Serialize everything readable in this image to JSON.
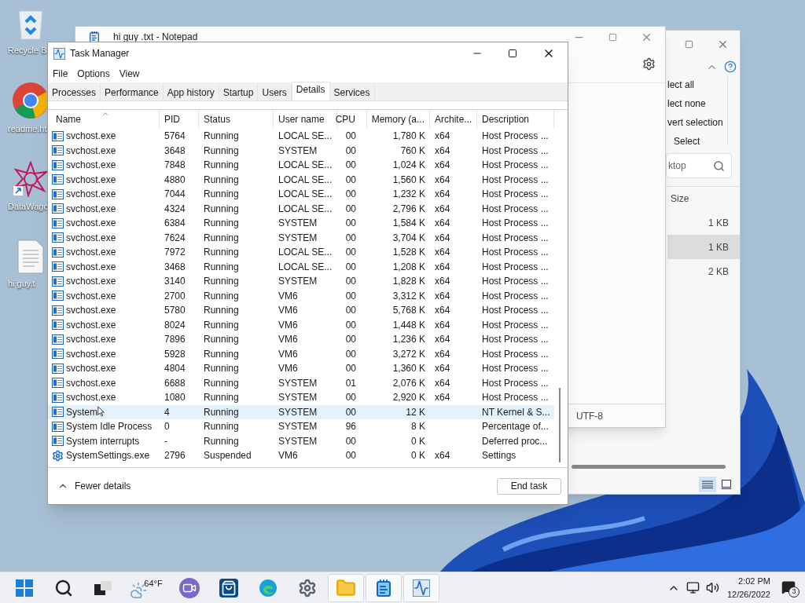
{
  "desktop_icons": [
    {
      "kind": "recycle",
      "label": "Recycle B"
    },
    {
      "kind": "browser",
      "label": "readme.ht"
    },
    {
      "kind": "shortcut",
      "label": "DataWago"
    },
    {
      "kind": "text_file",
      "label": "hi guy.t"
    }
  ],
  "explorer": {
    "ribbon_items": [
      "lect all",
      "lect none",
      "vert selection",
      "Select"
    ],
    "search": {
      "value": "ktop"
    },
    "column": "Size",
    "rows": [
      {
        "size": "1 KB",
        "selected": false
      },
      {
        "size": "1 KB",
        "selected": true
      },
      {
        "size": "2 KB",
        "selected": false
      }
    ],
    "views": [
      {
        "kind": "details",
        "selected": true
      },
      {
        "kind": "tiles",
        "selected": false
      }
    ]
  },
  "notepad": {
    "title": "hi guy .txt - Notepad",
    "encoding": "UTF-8"
  },
  "task_manager": {
    "title": "Task Manager",
    "menu": [
      "File",
      "Options",
      "View"
    ],
    "tabs": [
      {
        "label": "Processes",
        "selected": false
      },
      {
        "label": "Performance",
        "selected": false
      },
      {
        "label": "App history",
        "selected": false
      },
      {
        "label": "Startup",
        "selected": false
      },
      {
        "label": "Users",
        "selected": false
      },
      {
        "label": "Details",
        "selected": true
      },
      {
        "label": "Services",
        "selected": false
      }
    ],
    "columns": [
      "Name",
      "PID",
      "Status",
      "User name",
      "CPU",
      "Memory (a...",
      "Archite...",
      "Description"
    ],
    "rows": [
      {
        "kind": "app",
        "name": "svchost.exe",
        "pid": "5764",
        "status": "Running",
        "user": "LOCAL SE...",
        "cpu": "00",
        "memory": "1,780 K",
        "arch": "x64",
        "description": "Host Process ...",
        "selected": false
      },
      {
        "kind": "app",
        "name": "svchost.exe",
        "pid": "3648",
        "status": "Running",
        "user": "SYSTEM",
        "cpu": "00",
        "memory": "760 K",
        "arch": "x64",
        "description": "Host Process ...",
        "selected": false
      },
      {
        "kind": "app",
        "name": "svchost.exe",
        "pid": "7848",
        "status": "Running",
        "user": "LOCAL SE...",
        "cpu": "00",
        "memory": "1,024 K",
        "arch": "x64",
        "description": "Host Process ...",
        "selected": false
      },
      {
        "kind": "app",
        "name": "svchost.exe",
        "pid": "4880",
        "status": "Running",
        "user": "LOCAL SE...",
        "cpu": "00",
        "memory": "1,560 K",
        "arch": "x64",
        "description": "Host Process ...",
        "selected": false
      },
      {
        "kind": "app",
        "name": "svchost.exe",
        "pid": "7044",
        "status": "Running",
        "user": "LOCAL SE...",
        "cpu": "00",
        "memory": "1,232 K",
        "arch": "x64",
        "description": "Host Process ...",
        "selected": false
      },
      {
        "kind": "app",
        "name": "svchost.exe",
        "pid": "4324",
        "status": "Running",
        "user": "LOCAL SE...",
        "cpu": "00",
        "memory": "2,796 K",
        "arch": "x64",
        "description": "Host Process ...",
        "selected": false
      },
      {
        "kind": "app",
        "name": "svchost.exe",
        "pid": "6384",
        "status": "Running",
        "user": "SYSTEM",
        "cpu": "00",
        "memory": "1,584 K",
        "arch": "x64",
        "description": "Host Process ...",
        "selected": false
      },
      {
        "kind": "app",
        "name": "svchost.exe",
        "pid": "7624",
        "status": "Running",
        "user": "SYSTEM",
        "cpu": "00",
        "memory": "3,704 K",
        "arch": "x64",
        "description": "Host Process ...",
        "selected": false
      },
      {
        "kind": "app",
        "name": "svchost.exe",
        "pid": "7972",
        "status": "Running",
        "user": "LOCAL SE...",
        "cpu": "00",
        "memory": "1,528 K",
        "arch": "x64",
        "description": "Host Process ...",
        "selected": false
      },
      {
        "kind": "app",
        "name": "svchost.exe",
        "pid": "3468",
        "status": "Running",
        "user": "LOCAL SE...",
        "cpu": "00",
        "memory": "1,208 K",
        "arch": "x64",
        "description": "Host Process ...",
        "selected": false
      },
      {
        "kind": "app",
        "name": "svchost.exe",
        "pid": "3140",
        "status": "Running",
        "user": "SYSTEM",
        "cpu": "00",
        "memory": "1,828 K",
        "arch": "x64",
        "description": "Host Process ...",
        "selected": false
      },
      {
        "kind": "app",
        "name": "svchost.exe",
        "pid": "2700",
        "status": "Running",
        "user": "VM6",
        "cpu": "00",
        "memory": "3,312 K",
        "arch": "x64",
        "description": "Host Process ...",
        "selected": false
      },
      {
        "kind": "app",
        "name": "svchost.exe",
        "pid": "5780",
        "status": "Running",
        "user": "VM6",
        "cpu": "00",
        "memory": "5,768 K",
        "arch": "x64",
        "description": "Host Process ...",
        "selected": false
      },
      {
        "kind": "app",
        "name": "svchost.exe",
        "pid": "8024",
        "status": "Running",
        "user": "VM6",
        "cpu": "00",
        "memory": "1,448 K",
        "arch": "x64",
        "description": "Host Process ...",
        "selected": false
      },
      {
        "kind": "app",
        "name": "svchost.exe",
        "pid": "7896",
        "status": "Running",
        "user": "VM6",
        "cpu": "00",
        "memory": "1,236 K",
        "arch": "x64",
        "description": "Host Process ...",
        "selected": false
      },
      {
        "kind": "app",
        "name": "svchost.exe",
        "pid": "5928",
        "status": "Running",
        "user": "VM6",
        "cpu": "00",
        "memory": "3,272 K",
        "arch": "x64",
        "description": "Host Process ...",
        "selected": false
      },
      {
        "kind": "app",
        "name": "svchost.exe",
        "pid": "4804",
        "status": "Running",
        "user": "VM6",
        "cpu": "00",
        "memory": "1,360 K",
        "arch": "x64",
        "description": "Host Process ...",
        "selected": false
      },
      {
        "kind": "app",
        "name": "svchost.exe",
        "pid": "6688",
        "status": "Running",
        "user": "SYSTEM",
        "cpu": "01",
        "memory": "2,076 K",
        "arch": "x64",
        "description": "Host Process ...",
        "selected": false
      },
      {
        "kind": "app",
        "name": "svchost.exe",
        "pid": "1080",
        "status": "Running",
        "user": "SYSTEM",
        "cpu": "00",
        "memory": "2,920 K",
        "arch": "x64",
        "description": "Host Process ...",
        "selected": false
      },
      {
        "kind": "app",
        "name": "System",
        "pid": "4",
        "status": "Running",
        "user": "SYSTEM",
        "cpu": "00",
        "memory": "12 K",
        "description": "NT Kernel & S...",
        "selected": true
      },
      {
        "kind": "app",
        "name": "System Idle Process",
        "pid": "0",
        "status": "Running",
        "user": "SYSTEM",
        "cpu": "96",
        "memory": "8 K",
        "description": "Percentage of...",
        "selected": false
      },
      {
        "kind": "app",
        "name": "System interrupts",
        "pid": "-",
        "status": "Running",
        "user": "SYSTEM",
        "cpu": "00",
        "memory": "0 K",
        "description": "Deferred proc...",
        "selected": false
      },
      {
        "kind": "settings",
        "name": "SystemSettings.exe",
        "pid": "2796",
        "status": "Suspended",
        "user": "VM6",
        "cpu": "00",
        "memory": "0 K",
        "arch": "x64",
        "description": "Settings",
        "selected": false
      }
    ],
    "footer": {
      "toggle": "Fewer details",
      "button": "End task"
    }
  },
  "taskbar": {
    "apps": [
      {
        "kind": "start",
        "active": false
      },
      {
        "kind": "search",
        "active": false
      },
      {
        "kind": "task_view",
        "active": false
      },
      {
        "kind": "weather",
        "label": "64°F",
        "active": false
      },
      {
        "kind": "chat",
        "active": false
      },
      {
        "kind": "store",
        "active": false
      },
      {
        "kind": "edge",
        "active": false
      },
      {
        "kind": "settings",
        "active": false
      },
      {
        "kind": "files",
        "active": true
      },
      {
        "kind": "notepad",
        "active": true
      },
      {
        "kind": "task_manager",
        "active": true
      }
    ],
    "tray": {
      "time": "2:02 PM",
      "date": "12/26/2022",
      "notifications": "3"
    }
  }
}
